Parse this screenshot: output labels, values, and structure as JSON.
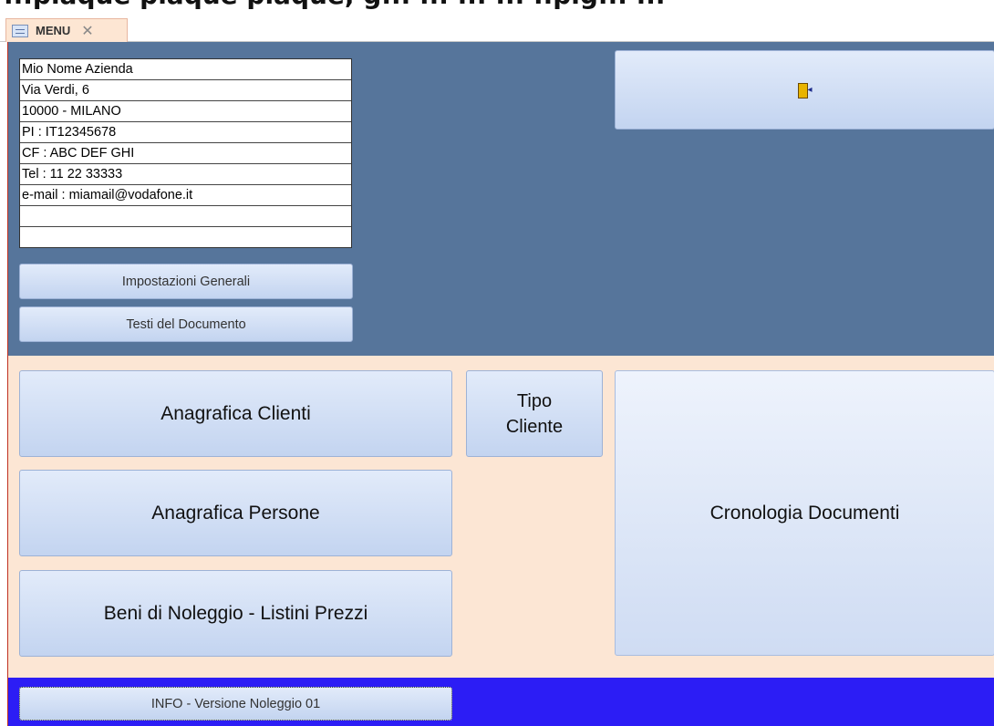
{
  "window": {
    "cut_title": "...plaque plaque plaque, g... ... ... ... ..pig... ..."
  },
  "tab": {
    "label": "MENU",
    "close_glyph": "✕"
  },
  "company": {
    "lines": [
      "Mio Nome Azienda",
      "Via Verdi, 6",
      "10000 - MILANO",
      "PI : IT12345678",
      "CF : ABC DEF GHI",
      "Tel : 11 22 33333",
      "e-mail : miamail@vodafone.it",
      "",
      ""
    ]
  },
  "buttons": {
    "impostazioni": "Impostazioni Generali",
    "testi": "Testi del Documento",
    "exit_icon": "exit-door-icon",
    "anagrafica_clienti": "Anagrafica Clienti",
    "tipo_cliente_line1": "Tipo",
    "tipo_cliente_line2": "Cliente",
    "anagrafica_persone": "Anagrafica Persone",
    "beni_noleggio": "Beni di Noleggio - Listini Prezzi",
    "cronologia": "Cronologia Documenti",
    "info": "INFO - Versione Noleggio 01"
  },
  "colors": {
    "header_bg": "#56759b",
    "detail_bg": "#fce6d4",
    "footer_bg": "#2c1df5",
    "button_top": "#e2ebfa",
    "button_bottom": "#c3d4f0"
  }
}
